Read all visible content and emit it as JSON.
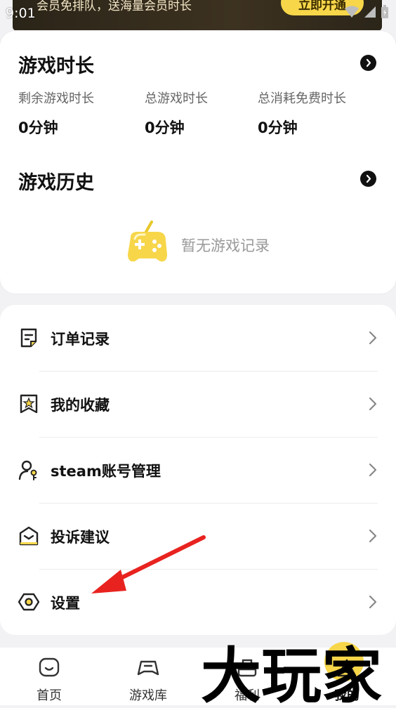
{
  "status": {
    "time": "9:01"
  },
  "banner": {
    "text": "会员免排队，送海量会员时长",
    "button_label": "立即开通"
  },
  "game_time": {
    "title": "游戏时长",
    "stats": [
      {
        "label": "剩余游戏时长",
        "value": "0分钟"
      },
      {
        "label": "总游戏时长",
        "value": "0分钟"
      },
      {
        "label": "总消耗免费时长",
        "value": "0分钟"
      }
    ]
  },
  "game_history": {
    "title": "游戏历史",
    "empty_text": "暂无游戏记录"
  },
  "menu": {
    "items": [
      {
        "label": "订单记录",
        "icon": "order-icon"
      },
      {
        "label": "我的收藏",
        "icon": "bookmark-star-icon"
      },
      {
        "label": "steam账号管理",
        "icon": "user-key-icon"
      },
      {
        "label": "投诉建议",
        "icon": "envelope-icon"
      },
      {
        "label": "设置",
        "icon": "settings-hex-icon"
      }
    ]
  },
  "bottom_nav": {
    "items": [
      {
        "label": "首页",
        "icon": "home-icon"
      },
      {
        "label": "游戏库",
        "icon": "gamepad-icon"
      },
      {
        "label": "福利",
        "icon": "gift-icon"
      },
      {
        "label": "我的",
        "icon": "profile-icon"
      }
    ]
  },
  "watermark": {
    "text": "大玩家"
  },
  "colors": {
    "accent": "#f7d64a",
    "annotation_arrow": "#e8231f",
    "banner_bg": "#2a2418"
  }
}
